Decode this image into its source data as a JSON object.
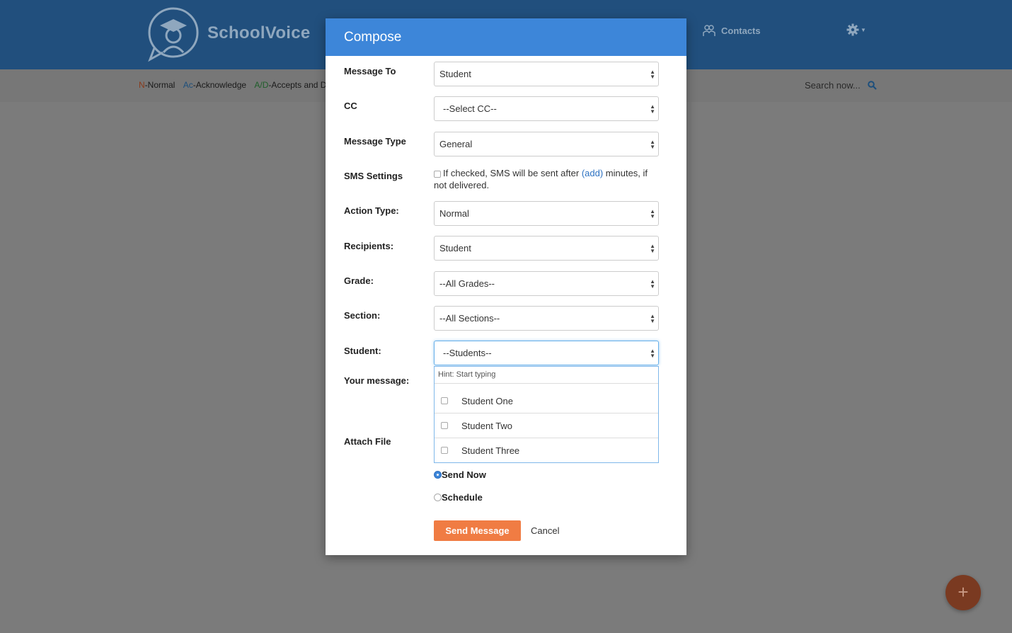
{
  "app": {
    "brand": "SchoolVoice",
    "nav_contacts": "Contacts",
    "legend": {
      "n_code": "N",
      "n_text": "-Normal",
      "ac_code": "Ac",
      "ac_text": "-Acknowledge",
      "ad_code": "A/D",
      "ad_text": "-Accepts and Dec"
    },
    "search_placeholder": "Search now...",
    "fab_label": "+"
  },
  "modal": {
    "title": "Compose",
    "fields": {
      "message_to": {
        "label": "Message To",
        "value": "Student"
      },
      "cc": {
        "label": "CC",
        "value": "--Select CC--"
      },
      "message_type": {
        "label": "Message Type",
        "value": "General"
      },
      "sms": {
        "label": "SMS Settings",
        "text_before": "If checked, SMS will be sent after ",
        "link": "(add)",
        "text_after": " minutes, if not delivered."
      },
      "action_type": {
        "label": "Action Type:",
        "value": "Normal"
      },
      "recipients": {
        "label": "Recipients:",
        "value": "Student"
      },
      "grade": {
        "label": "Grade:",
        "value": "--All Grades--"
      },
      "section": {
        "label": "Section:",
        "value": "--All Sections--"
      },
      "student": {
        "label": "Student:",
        "value": "--Students--"
      },
      "message": {
        "label": "Your message:"
      },
      "attach": {
        "label": "Attach File"
      }
    },
    "student_dropdown": {
      "hint": "Hint: Start typing",
      "options": [
        "Student One",
        "Student Two",
        "Student Three"
      ]
    },
    "send_options": {
      "send_now": "Send Now",
      "schedule": "Schedule",
      "selected": "Send Now"
    },
    "send_button": "Send Message",
    "cancel_button": "Cancel"
  },
  "colors": {
    "header_bg": "#214f7d",
    "modal_header": "#3d86d9",
    "send_button": "#f07c43",
    "link": "#2d72c2"
  }
}
